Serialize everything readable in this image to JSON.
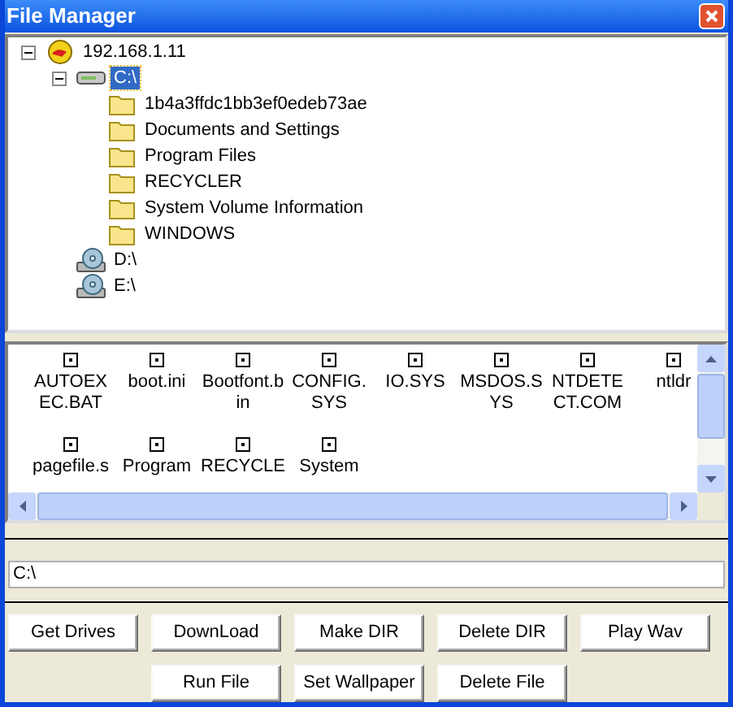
{
  "window": {
    "title": "File Manager"
  },
  "tree": [
    {
      "label": "192.168.1.11",
      "kind": "computer",
      "expanded": true,
      "selected": false,
      "children": [
        {
          "label": "C:\\",
          "kind": "harddisk",
          "expanded": true,
          "selected": true,
          "children": [
            {
              "label": "1b4a3ffdc1bb3ef0edeb73ae",
              "kind": "folder",
              "selected": false
            },
            {
              "label": "Documents and Settings",
              "kind": "folder",
              "selected": false
            },
            {
              "label": "Program Files",
              "kind": "folder",
              "selected": false
            },
            {
              "label": "RECYCLER",
              "kind": "folder",
              "selected": false
            },
            {
              "label": "System Volume Information",
              "kind": "folder",
              "selected": false
            },
            {
              "label": "WINDOWS",
              "kind": "folder",
              "selected": false
            }
          ]
        },
        {
          "label": "D:\\",
          "kind": "cdrom",
          "selected": false
        },
        {
          "label": "E:\\",
          "kind": "cdrom",
          "selected": false
        }
      ]
    }
  ],
  "files": [
    {
      "lines": [
        "AUTOEX",
        "EC.BAT"
      ]
    },
    {
      "lines": [
        "boot.ini"
      ]
    },
    {
      "lines": [
        "Bootfont.b",
        "in"
      ]
    },
    {
      "lines": [
        "CONFIG.",
        "SYS"
      ]
    },
    {
      "lines": [
        "IO.SYS"
      ]
    },
    {
      "lines": [
        "MSDOS.S",
        "YS"
      ]
    },
    {
      "lines": [
        "NTDETE",
        "CT.COM"
      ]
    },
    {
      "lines": [
        "ntldr"
      ]
    },
    {
      "lines": [
        "pagefile.s"
      ]
    },
    {
      "lines": [
        "Program"
      ]
    },
    {
      "lines": [
        "RECYCLE"
      ]
    },
    {
      "lines": [
        "System"
      ]
    }
  ],
  "path": {
    "value": "C:\\"
  },
  "buttons": [
    [
      "Get Drives",
      "DownLoad",
      "Make DIR",
      "Delete DIR",
      "Play Wav"
    ],
    [
      "Run File",
      "Set Wallpaper",
      "Delete File"
    ]
  ]
}
